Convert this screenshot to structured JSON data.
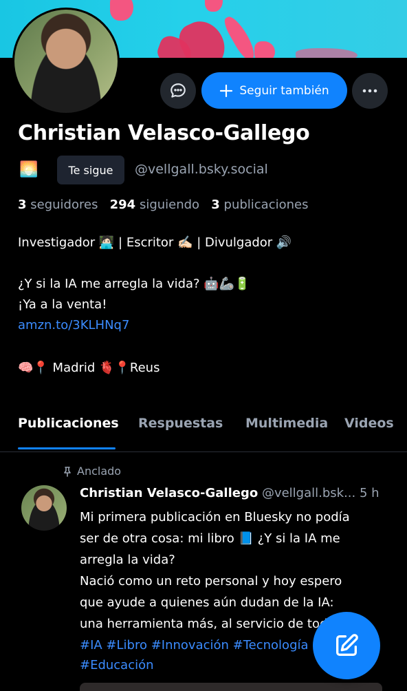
{
  "profile": {
    "name": "Christian Velasco-Gallego",
    "status_emoji": "🌅",
    "follows_you_label": "Te sigue",
    "handle": "@vellgall.bsky.social",
    "stats": {
      "followers_count": "3",
      "followers_label": "seguidores",
      "following_count": "294",
      "following_label": "siguiendo",
      "posts_count": "3",
      "posts_label": "publicaciones"
    },
    "bio": {
      "line1": "Investigador 🧑🏻‍💻 | Escritor ✍🏻 | Divulgador 🔊",
      "line2": "¿Y si la IA me arregla la vida? 🤖🦾🔋",
      "line3": "¡Ya a la venta!",
      "link": "amzn.to/3KLHNq7",
      "line4": "🧠📍 Madrid 🫀📍Reus"
    }
  },
  "actions": {
    "follow_label": "Seguir también"
  },
  "tabs": [
    {
      "label": "Publicaciones",
      "active": true
    },
    {
      "label": "Respuestas",
      "active": false
    },
    {
      "label": "Multimedia",
      "active": false
    },
    {
      "label": "Videos",
      "active": false
    }
  ],
  "post": {
    "pinned_label": "Anclado",
    "author": "Christian Velasco-Gallego",
    "handle_truncated": "@vellgall.bsk...",
    "time": "5 h",
    "lines": [
      "Mi primera publicación en Bluesky no podía",
      "ser de otra cosa: mi libro 📘 ¿Y si la IA me",
      "arregla la vida?",
      "Nació como un reto personal y hoy espero",
      "que ayude a quienes aún dudan de la IA:",
      "una herramienta más, al servicio de todos."
    ],
    "hashtags_line1": "#IA #Libro #Innovación #Tecnología",
    "hashtags_line2": "#Educación"
  },
  "colors": {
    "accent": "#1083fe",
    "link": "#3b8cff",
    "muted": "#9aa4b2",
    "background": "#000000",
    "banner": "#25d0ea"
  },
  "icons": [
    "message-icon",
    "plus-icon",
    "more-icon",
    "pin-icon",
    "compose-icon"
  ]
}
